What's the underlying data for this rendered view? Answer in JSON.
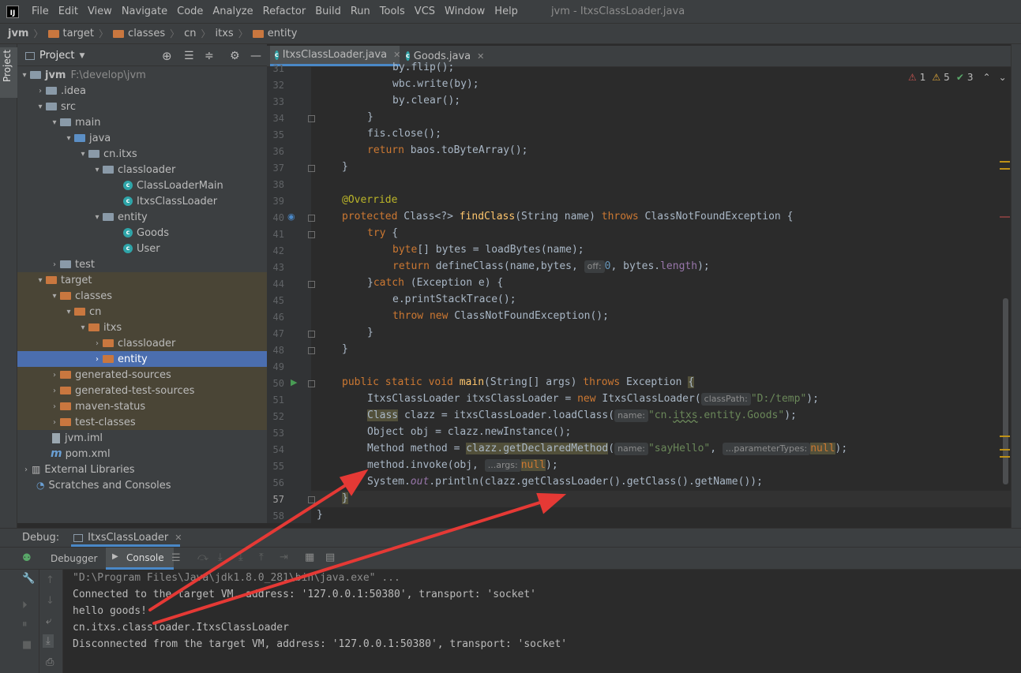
{
  "menubar": {
    "logo": "IJ",
    "items": [
      "File",
      "Edit",
      "View",
      "Navigate",
      "Code",
      "Analyze",
      "Refactor",
      "Build",
      "Run",
      "Tools",
      "VCS",
      "Window",
      "Help"
    ],
    "window_title": "jvm - ItxsClassLoader.java"
  },
  "breadcrumbs": [
    "jvm",
    "target",
    "classes",
    "cn",
    "itxs",
    "entity"
  ],
  "left_strip": {
    "project_label": "Project"
  },
  "project_panel": {
    "title": "Project",
    "tree": [
      {
        "label": "jvm",
        "extra": "F:\\develop\\jvm",
        "icon": "module-folder-icon"
      },
      {
        "label": ".idea",
        "icon": "folder-icon"
      },
      {
        "label": "src",
        "icon": "folder-icon"
      },
      {
        "label": "main",
        "icon": "folder-icon"
      },
      {
        "label": "java",
        "icon": "source-folder-icon"
      },
      {
        "label": "cn.itxs",
        "icon": "package-icon"
      },
      {
        "label": "classloader",
        "icon": "package-icon"
      },
      {
        "label": "ClassLoaderMain",
        "icon": "class-icon"
      },
      {
        "label": "ItxsClassLoader",
        "icon": "class-icon"
      },
      {
        "label": "entity",
        "icon": "package-icon"
      },
      {
        "label": "Goods",
        "icon": "class-icon"
      },
      {
        "label": "User",
        "icon": "class-icon"
      },
      {
        "label": "test",
        "icon": "folder-icon"
      },
      {
        "label": "target",
        "icon": "excluded-folder-icon"
      },
      {
        "label": "classes",
        "icon": "excluded-folder-icon"
      },
      {
        "label": "cn",
        "icon": "excluded-folder-icon"
      },
      {
        "label": "itxs",
        "icon": "excluded-folder-icon"
      },
      {
        "label": "classloader",
        "icon": "excluded-folder-icon"
      },
      {
        "label": "entity",
        "icon": "excluded-folder-icon"
      },
      {
        "label": "generated-sources",
        "icon": "excluded-folder-icon"
      },
      {
        "label": "generated-test-sources",
        "icon": "excluded-folder-icon"
      },
      {
        "label": "maven-status",
        "icon": "excluded-folder-icon"
      },
      {
        "label": "test-classes",
        "icon": "excluded-folder-icon"
      },
      {
        "label": "jvm.iml",
        "icon": "iml-file-icon"
      },
      {
        "label": "pom.xml",
        "icon": "maven-icon"
      },
      {
        "label": "External Libraries",
        "icon": "libraries-icon"
      },
      {
        "label": "Scratches and Consoles",
        "icon": "scratches-icon"
      }
    ]
  },
  "editor_tabs": [
    {
      "label": "ItxsClassLoader.java",
      "active": true
    },
    {
      "label": "Goods.java",
      "active": false
    }
  ],
  "inspections": {
    "errors": "1",
    "warnings": "5",
    "ok": "3"
  },
  "code": {
    "line_numbers": [
      "31",
      "32",
      "33",
      "34",
      "35",
      "36",
      "37",
      "38",
      "39",
      "40",
      "41",
      "42",
      "43",
      "44",
      "45",
      "46",
      "47",
      "48",
      "49",
      "50",
      "51",
      "52",
      "53",
      "54",
      "55",
      "56",
      "57",
      "58"
    ],
    "l31": "by.flip();",
    "l32": "wbc.write(by);",
    "l33": "by.clear();",
    "l34": "}",
    "l35a": "fis.close();",
    "l36_kw": "return",
    "l36": " baos.toByteArray();",
    "l37": "}",
    "l39": "@Override",
    "l40_kw1": "protected",
    "l40_a": " Class<?> ",
    "l40_fn": "findClass",
    "l40_b": "(String name) ",
    "l40_kw2": "throws",
    "l40_c": " ClassNotFoundException {",
    "l41_kw": "try",
    "l41": " {",
    "l42_kw": "byte",
    "l42": "[] bytes = loadBytes(name);",
    "l43_kw": "return",
    "l43_a": " defineClass(name,bytes, ",
    "l43_hint": "off:",
    "l43_num": "0",
    "l43_b": ", bytes.",
    "l43_fld": "length",
    "l43_c": ");",
    "l44_a": "}",
    "l44_kw": "catch",
    "l44_b": " (Exception e) {",
    "l45": "e.printStackTrace();",
    "l46_kw1": "throw",
    "l46_kw2": "new",
    "l46": " ClassNotFoundException();",
    "l47": "}",
    "l48": "}",
    "l50_kw": "public static void",
    "l50_fn": "main",
    "l50_a": "(String[] args) ",
    "l50_kw2": "throws",
    "l50_b": " Exception ",
    "l50_brace": "{",
    "l51_a": "ItxsClassLoader itxsClassLoader = ",
    "l51_kw": "new",
    "l51_b": " ItxsClassLoader(",
    "l51_hint": "classPath:",
    "l51_str": "\"D:/temp\"",
    "l51_c": ");",
    "l52_cls": "Class",
    "l52_a": " clazz = itxsClassLoader.loadClass(",
    "l52_hint": "name:",
    "l52_str1": "\"cn.",
    "l52_str2": "itxs",
    "l52_str3": ".entity.Goods\"",
    "l52_c": ");",
    "l53": "Object obj = clazz.newInstance();",
    "l54_a": "Method method = ",
    "l54_hl": "clazz.getDeclaredMethod",
    "l54_b": "(",
    "l54_hint1": "name:",
    "l54_str": "\"sayHello\"",
    "l54_c": ", ",
    "l54_hint2": "...parameterTypes:",
    "l54_null": "null",
    "l54_d": ");",
    "l55_a": "method.invoke(obj, ",
    "l55_hint": "...args:",
    "l55_null": "null",
    "l55_b": ");",
    "l56_a": "System.",
    "l56_stat": "out",
    "l56_b": ".println(clazz.getClassLoader().getClass().getName());",
    "l57": "}",
    "l58": "}"
  },
  "debug": {
    "label": "Debug:",
    "session": "ItxsClassLoader",
    "tabs": [
      "Debugger",
      "Console"
    ]
  },
  "console": {
    "lines": [
      "\"D:\\Program Files\\Java\\jdk1.8.0_281\\bin\\java.exe\" ...",
      "Connected to the target VM, address: '127.0.0.1:50380', transport: 'socket'",
      "hello goods!",
      "cn.itxs.classloader.ItxsClassLoader",
      "Disconnected from the target VM, address: '127.0.0.1:50380', transport: 'socket'"
    ]
  },
  "colors": {
    "accent": "#4b6eaf",
    "annotation_arrows": "#e53935",
    "keyword": "#cc7832",
    "string": "#6a8759"
  }
}
